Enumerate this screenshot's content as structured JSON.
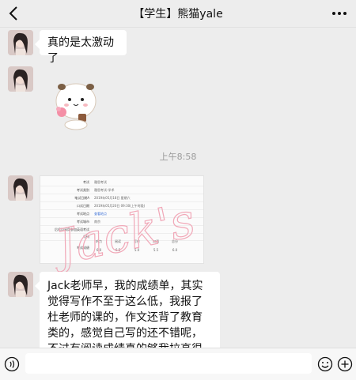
{
  "header": {
    "title": "【学生】熊猫yale",
    "back_icon": "chevron-left-icon",
    "more_icon": "more-dots-icon"
  },
  "messages": [
    {
      "type": "text",
      "text": "真的是太激动了"
    },
    {
      "type": "sticker",
      "icon": "panda-sticker"
    },
    {
      "type": "time",
      "text": "上午8:58"
    },
    {
      "type": "image",
      "report": {
        "rows": [
          {
            "key": "考试",
            "value": "雅思考试"
          },
          {
            "key": "考试类别",
            "value": "雅思考试-学术"
          },
          {
            "key": "笔试日期A",
            "value": "2019年05月18日 星期六"
          },
          {
            "key": "口试日期",
            "value": "2019年05月20日 09:30(上午时段)"
          },
          {
            "key": "考试地点",
            "value": "查看地点"
          },
          {
            "key": "考试城市",
            "value": "南京"
          },
          {
            "key": "后续可采用参加英语考试",
            "value": ""
          },
          {
            "key": "号码",
            "value": ""
          }
        ],
        "scores_label": "考试成绩",
        "score_headers": [
          "听力",
          "阅读",
          "写作",
          "口语",
          "总分"
        ],
        "score_values": [
          "6.0",
          "6.5",
          "5.0",
          "5.5",
          "6.0"
        ]
      },
      "watermark": "Jack's"
    },
    {
      "type": "text",
      "text": "Jack老师早，我的成绩单，其实觉得写作不至于这么低，我报了杜老师的课的，作文还背了教育类的，感觉自己写的还不错呢，不过有阅读成绩真的够我拉高很多写作成绩"
    }
  ],
  "input_bar": {
    "placeholder": "",
    "voice_icon": "voice-icon",
    "emoji_icon": "emoji-icon",
    "plus_icon": "plus-icon"
  }
}
